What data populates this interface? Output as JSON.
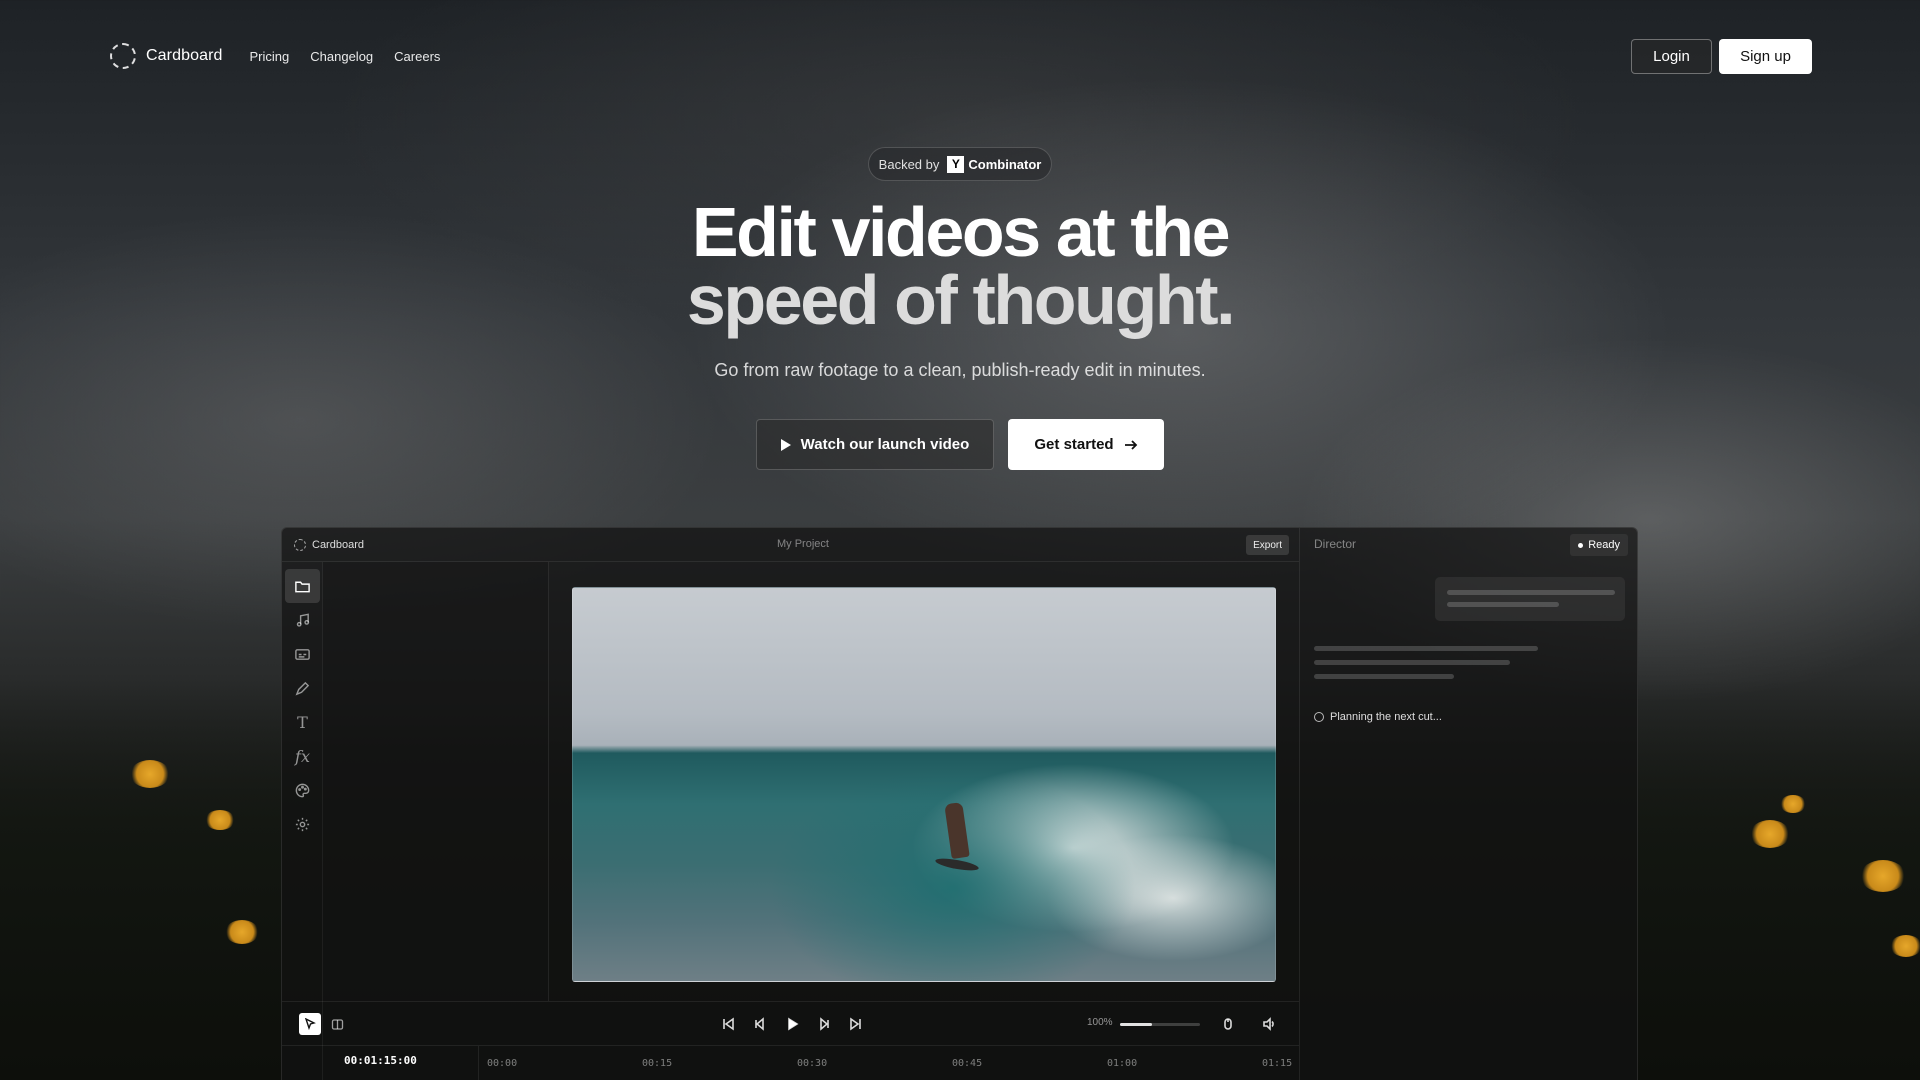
{
  "nav": {
    "brand": "Cardboard",
    "links": [
      "Pricing",
      "Changelog",
      "Careers"
    ],
    "login": "Login",
    "signup": "Sign up"
  },
  "hero": {
    "badge_prefix": "Backed by",
    "badge_logo_letter": "Y",
    "badge_name": "Combinator",
    "title_line1": "Edit videos at the",
    "title_line2": "speed of thought.",
    "subtitle": "Go from raw footage to a clean, publish-ready edit in minutes.",
    "cta_watch": "Watch our launch video",
    "cta_start": "Get started"
  },
  "app": {
    "name": "Cardboard",
    "project": "My Project",
    "export": "Export",
    "sidebar_icons": [
      "folder-icon",
      "music-icon",
      "captions-icon",
      "pen-icon",
      "text-icon",
      "fx-icon",
      "palette-icon",
      "settings-icon"
    ],
    "fx_label": "fx",
    "text_label": "T",
    "zoom": "100%",
    "zoom_level": 0.4,
    "timecode": "00:01:15:00",
    "ticks": [
      "00:00",
      "00:15",
      "00:30",
      "00:45",
      "01:00",
      "01:15"
    ]
  },
  "director": {
    "title": "Director",
    "status": "Ready",
    "planning": "Planning the next cut..."
  }
}
